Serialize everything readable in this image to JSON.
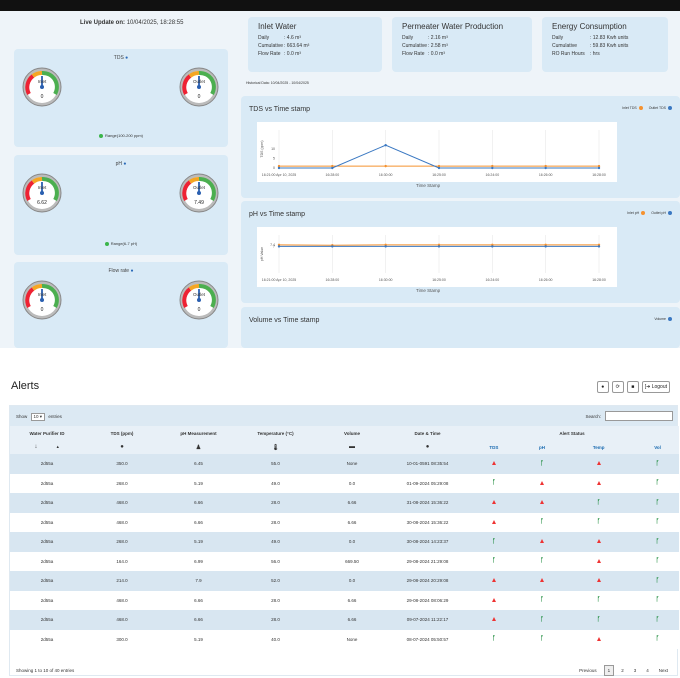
{
  "live_update": {
    "label": "Live Update on:",
    "value": "10/04/2025, 18:28:55"
  },
  "gauges": [
    {
      "title": "TDS",
      "icon": "droplet-icon",
      "inlet_label": "Inlet",
      "inlet_value": "0",
      "outlet_label": "Outlet",
      "outlet_value": "0",
      "range": "Range(100-200 ppm)"
    },
    {
      "title": "pH",
      "icon": "flask-icon",
      "inlet_label": "Inlet",
      "inlet_value": "6.62",
      "outlet_label": "Outlet",
      "outlet_value": "7.49",
      "range": "Range(6-7 pH)"
    },
    {
      "title": "Flow rate",
      "icon": "flow-icon",
      "inlet_label": "Inlet",
      "inlet_value": "0",
      "outlet_label": "Outlet",
      "outlet_value": "0",
      "range": ""
    }
  ],
  "water_cards": [
    {
      "title": "Inlet Water",
      "rows": [
        {
          "k": "Daily",
          "v": ": 4.6 m³"
        },
        {
          "k": "Cumulative",
          "v": ": 663.64 m³"
        },
        {
          "k": "Flow Rate",
          "v": ": 0.0 m³"
        }
      ]
    },
    {
      "title": "Permeater Water Production",
      "rows": [
        {
          "k": "Daily",
          "v": ": 2.16 m³"
        },
        {
          "k": "Cumulative",
          "v": ": 2.58 m³"
        },
        {
          "k": "Flow Rate",
          "v": ": 0.0 m³"
        }
      ]
    },
    {
      "title": "Energy Consumption",
      "rows": [
        {
          "k": "Daily",
          "v": ": 12.83 Kwh units"
        },
        {
          "k": "Cumulative",
          "v": ": 59.83 Kwh units"
        },
        {
          "k": "RO Run Hours",
          "v": ": hrs"
        }
      ]
    }
  ],
  "historical": "Historical Data: 10/04/2025 - 10/04/2025",
  "chart_data": [
    {
      "type": "line",
      "title": "TDS vs Time stamp",
      "xlabel": "Time Stamp",
      "ylabel": "TDS (ppm)",
      "categories": [
        "16:21:00\nApr 10, 2025",
        "16:28:00",
        "16:30:00",
        "16:25:00",
        "16:24:00",
        "16:26:00",
        "16:28:00"
      ],
      "ylim": [
        0,
        20
      ],
      "yticks": [
        "0",
        "5",
        "10"
      ],
      "series": [
        {
          "name": "Inlet TDS",
          "color": "#f5922f",
          "values": [
            1,
            1,
            1,
            1,
            1,
            1,
            1
          ]
        },
        {
          "name": "Outlet TDS",
          "color": "#3a78c2",
          "values": [
            0,
            0,
            12,
            0,
            0,
            0,
            0
          ]
        }
      ]
    },
    {
      "type": "line",
      "title": "pH vs Time stamp",
      "xlabel": "Time Stamp",
      "ylabel": "pH Value",
      "categories": [
        "16:21:00\nApr 10, 2025",
        "16:28:00",
        "16:30:00",
        "16:25:00",
        "16:24:00",
        "16:26:00",
        "16:28:00"
      ],
      "ylim": [
        0,
        10
      ],
      "yticks": [
        "7.4",
        "7"
      ],
      "series": [
        {
          "name": "Inlet pH",
          "color": "#f5922f",
          "values": [
            7.4,
            7.3,
            7.4,
            7.4,
            7.4,
            7.4,
            7.4
          ]
        },
        {
          "name": "Outlet pH",
          "color": "#3a78c2",
          "values": [
            7.0,
            7.0,
            7.0,
            7.0,
            7.0,
            7.0,
            7.0
          ]
        }
      ]
    },
    {
      "type": "line",
      "title": "Volume vs Time stamp",
      "series": [
        {
          "name": "Volume",
          "color": "#3a78c2",
          "values": []
        }
      ]
    }
  ],
  "alerts": {
    "title": "Alerts",
    "buttons": [
      "person-icon",
      "refresh-icon",
      "save-icon",
      "Logout"
    ],
    "show_label": "Show",
    "show_value": "10",
    "entries_label": "entries",
    "search_label": "Search:",
    "headers": [
      "Water Purifier ID",
      "TDS (ppm)",
      "pH Measurement",
      "Temperature (°C)",
      "Volume",
      "Date & Time",
      "Alert Status"
    ],
    "status_headers": [
      "TDS",
      "pH",
      "Temp",
      "Vol"
    ],
    "rows": [
      {
        "id": "2d55a",
        "tds": "350.0",
        "ph": "6.45",
        "temp": "55.0",
        "vol": "None",
        "dt": "10-01-0591 08:35:54",
        "s": [
          "alert",
          "ok",
          "alert",
          "ok"
        ]
      },
      {
        "id": "2d55a",
        "tds": "268.0",
        "ph": "5.19",
        "temp": "49.0",
        "vol": "0.0",
        "dt": "01-09-2024 05:29:08",
        "s": [
          "ok",
          "alert",
          "alert",
          "ok"
        ]
      },
      {
        "id": "2d55a",
        "tds": "468.0",
        "ph": "6.66",
        "temp": "28.0",
        "vol": "6.66",
        "dt": "31-08-2024 15:36:22",
        "s": [
          "alert",
          "alert",
          "ok",
          "ok"
        ]
      },
      {
        "id": "2d55a",
        "tds": "468.0",
        "ph": "6.66",
        "temp": "28.0",
        "vol": "6.66",
        "dt": "30-08-2024 15:36:22",
        "s": [
          "alert",
          "ok",
          "ok",
          "ok"
        ]
      },
      {
        "id": "2d55a",
        "tds": "268.0",
        "ph": "5.19",
        "temp": "49.0",
        "vol": "0.0",
        "dt": "30-08-2024 14:23:37",
        "s": [
          "ok",
          "alert",
          "alert",
          "ok"
        ]
      },
      {
        "id": "2d55a",
        "tds": "164.0",
        "ph": "6.99",
        "temp": "56.0",
        "vol": "669.50",
        "dt": "29-08-2024 21:29:08",
        "s": [
          "ok",
          "ok",
          "alert",
          "ok"
        ]
      },
      {
        "id": "2d55a",
        "tds": "214.0",
        "ph": "7.9",
        "temp": "52.0",
        "vol": "0.0",
        "dt": "29-08-2024 20:29:08",
        "s": [
          "alert",
          "alert",
          "alert",
          "ok"
        ]
      },
      {
        "id": "2d55a",
        "tds": "468.0",
        "ph": "6.66",
        "temp": "28.0",
        "vol": "6.66",
        "dt": "29-08-2024 08:06:29",
        "s": [
          "alert",
          "ok",
          "ok",
          "ok"
        ]
      },
      {
        "id": "2d55a",
        "tds": "468.0",
        "ph": "6.66",
        "temp": "28.0",
        "vol": "6.66",
        "dt": "09-07-2024 11:22:17",
        "s": [
          "alert",
          "ok",
          "ok",
          "ok"
        ]
      },
      {
        "id": "2d55a",
        "tds": "300.0",
        "ph": "5.19",
        "temp": "40.0",
        "vol": "None",
        "dt": "08-07-2024 05:50:57",
        "s": [
          "ok",
          "ok",
          "alert",
          "ok"
        ]
      }
    ],
    "showing": "Showing 1 to 10 of 40 entries",
    "pager": [
      "Previous",
      "1",
      "2",
      "3",
      "4",
      "Next"
    ],
    "active_page": "1"
  }
}
